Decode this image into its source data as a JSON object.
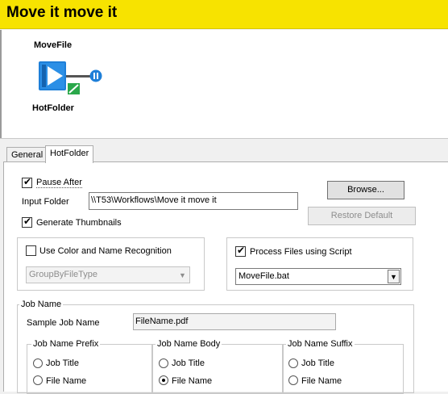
{
  "header": {
    "title": "Move it move it"
  },
  "canvas": {
    "node_top_label": "MoveFile",
    "node_bottom_label": "HotFolder"
  },
  "tabs": [
    {
      "label": "General"
    },
    {
      "label": "HotFolder"
    }
  ],
  "form": {
    "pause_after_label": "Pause After",
    "pause_after_checked": true,
    "input_folder_label": "Input Folder",
    "input_folder_value": "\\\\T53\\Workflows\\Move it move it",
    "browse_label": "Browse...",
    "restore_default_label": "Restore Default",
    "generate_thumbnails_label": "Generate Thumbnails",
    "generate_thumbnails_checked": true,
    "color_name_recognition_label": "Use Color and Name Recognition",
    "color_name_recognition_checked": false,
    "group_select_value": "GroupByFileType",
    "process_script_label": "Process Files using Script",
    "process_script_checked": true,
    "script_select_value": "MoveFile.bat"
  },
  "job_name": {
    "legend": "Job Name",
    "sample_label": "Sample Job Name",
    "sample_value": "FileName.pdf",
    "prefix": {
      "legend": "Job Name Prefix",
      "options": [
        "Job Title",
        "File Name"
      ],
      "selected": null
    },
    "body": {
      "legend": "Job Name Body",
      "options": [
        "Job Title",
        "File Name"
      ],
      "selected": "File Name"
    },
    "suffix": {
      "legend": "Job Name Suffix",
      "options": [
        "Job Title",
        "File Name"
      ],
      "selected": null
    }
  },
  "colors": {
    "title_bar": "#f7e300",
    "node_blue": "#1e7fd8",
    "node_green": "#2aa84a"
  }
}
